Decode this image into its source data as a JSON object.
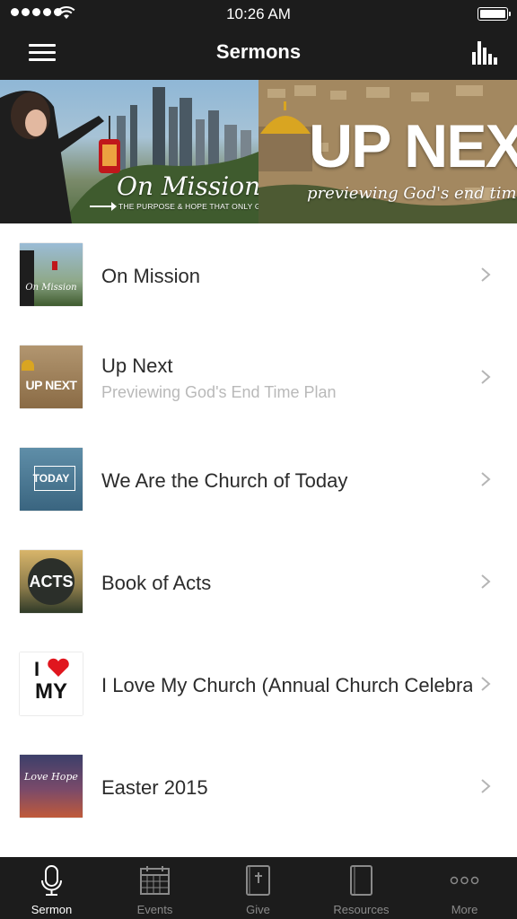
{
  "status_bar": {
    "time": "10:26 AM"
  },
  "navbar": {
    "title": "Sermons",
    "menu_icon": "hamburger-menu-icon",
    "stats_icon": "bar-chart-icon"
  },
  "banner": {
    "left": {
      "title": "On Mission",
      "subtitle": "THE PURPOSE & HOPE THAT ONLY GOD CAN GIVE"
    },
    "right": {
      "title": "UP NEXT",
      "subtitle": "previewing God's end time plan"
    }
  },
  "sermons": [
    {
      "title": "On Mission",
      "subtitle": "",
      "thumb_text": "On Mission"
    },
    {
      "title": "Up Next",
      "subtitle": "Previewing God's End Time Plan",
      "thumb_text": "UP NEXT"
    },
    {
      "title": "We Are the Church of Today",
      "subtitle": "",
      "thumb_text": "TODAY"
    },
    {
      "title": "Book of Acts",
      "subtitle": "",
      "thumb_text": "ACTS"
    },
    {
      "title": "I Love My Church (Annual Church Celebration)",
      "subtitle": "",
      "thumb_text": "MY"
    },
    {
      "title": "Easter 2015",
      "subtitle": "",
      "thumb_text": "Love Hope"
    }
  ],
  "tabs": [
    {
      "label": "Sermon",
      "icon": "microphone-icon",
      "active": true
    },
    {
      "label": "Events",
      "icon": "calendar-icon",
      "active": false
    },
    {
      "label": "Give",
      "icon": "bible-icon",
      "active": false
    },
    {
      "label": "Resources",
      "icon": "book-icon",
      "active": false
    },
    {
      "label": "More",
      "icon": "more-dots-icon",
      "active": false
    }
  ]
}
